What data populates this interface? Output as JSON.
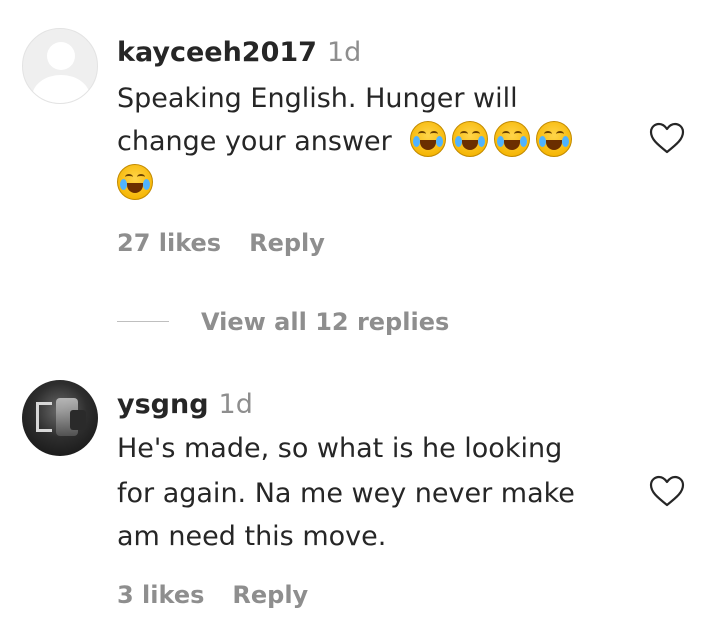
{
  "comments": [
    {
      "username": "kayceeh2017",
      "time": "1d",
      "text_line1": "Speaking English. Hunger will",
      "text_line2": "change your answer",
      "emoji_count": 5,
      "emoji_name": "face-with-tears-of-joy",
      "likes": "27 likes",
      "reply": "Reply",
      "view_replies": "View all 12 replies"
    },
    {
      "username": "ysgng",
      "time": "1d",
      "text_line1": "He's made, so what is he looking",
      "text_line2": "for again. Na me wey never make",
      "text_line3": "am need this move.",
      "likes": "3 likes",
      "reply": "Reply"
    }
  ],
  "icons": {
    "like": "heart-outline-icon"
  },
  "colors": {
    "text": "#262626",
    "secondary": "#8e8e8e",
    "background": "#ffffff"
  }
}
